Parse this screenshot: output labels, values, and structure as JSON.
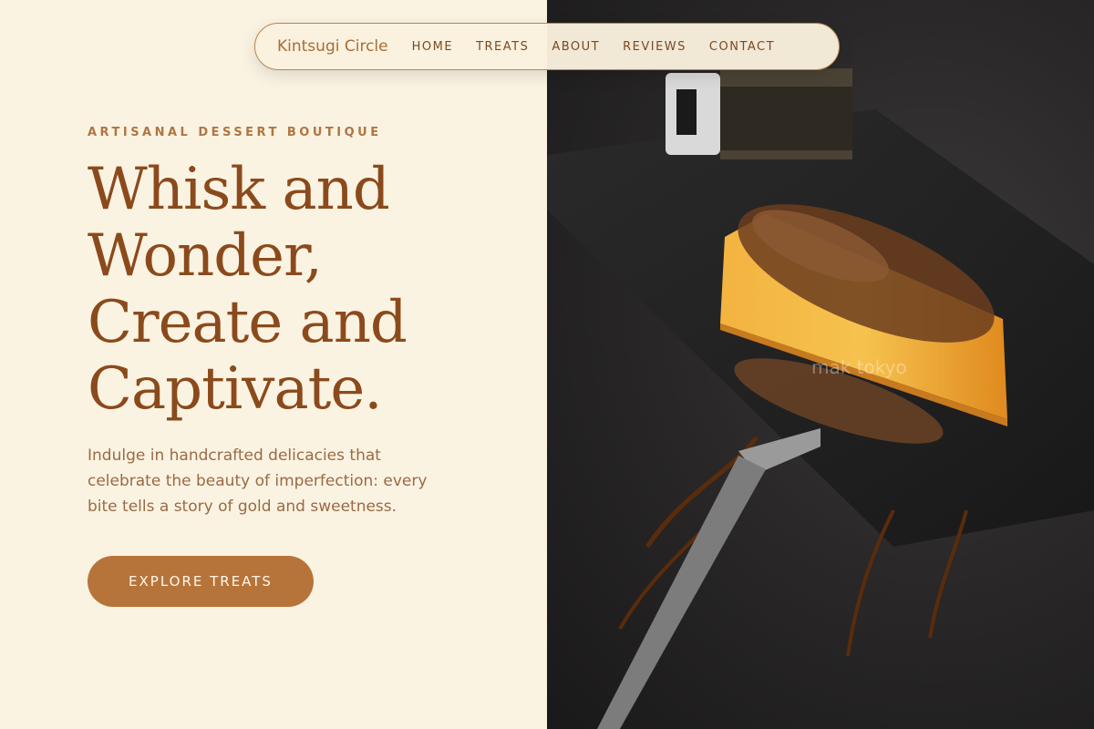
{
  "nav": {
    "brand": "Kintsugi Circle",
    "links": [
      "HOME",
      "TREATS",
      "ABOUT",
      "REVIEWS",
      "CONTACT"
    ]
  },
  "hero": {
    "eyebrow": "ARTISANAL DESSERT BOUTIQUE",
    "headline_lines": [
      "Whisk and",
      "Wonder,",
      "Create and",
      "Captivate."
    ],
    "lede": "Indulge in handcrafted delicacies that celebrate the beauty of imperfection: every bite tells a story of gold and sweetness.",
    "cta_label": "EXPLORE TREATS"
  },
  "image": {
    "watermark": "mak tokyo"
  },
  "colors": {
    "background": "#fbf3e2",
    "accent": "#b7743a",
    "heading": "#8b4a1c"
  }
}
